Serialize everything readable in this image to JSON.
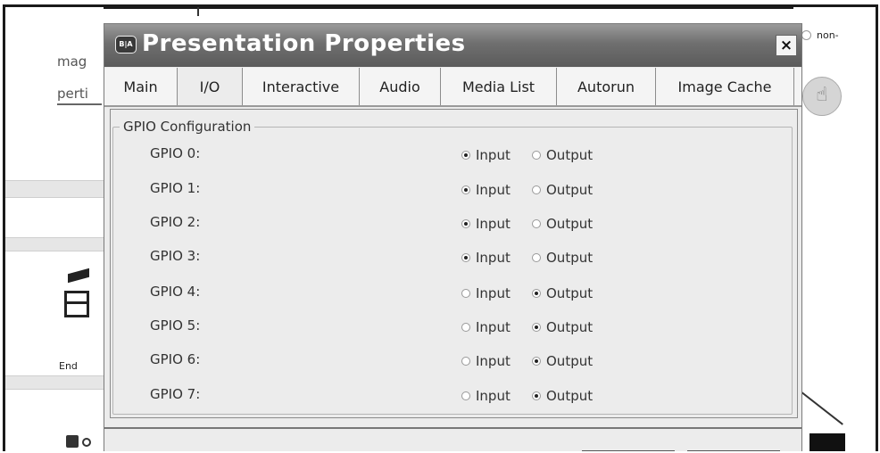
{
  "background": {
    "left_texts": [
      "mag",
      "perti",
      "End"
    ],
    "right_option": "non-"
  },
  "dialog": {
    "title": "Presentation Properties",
    "app_icon_text": "B|A",
    "close_glyph": "×",
    "tabs": [
      {
        "label": "Main",
        "active": false
      },
      {
        "label": "I/O",
        "active": true
      },
      {
        "label": "Interactive",
        "active": false
      },
      {
        "label": "Audio",
        "active": false
      },
      {
        "label": "Media List",
        "active": false
      },
      {
        "label": "Autorun",
        "active": false
      },
      {
        "label": "Image Cache",
        "active": false
      }
    ],
    "group_title": "GPIO Configuration",
    "option_input": "Input",
    "option_output": "Output",
    "gpio": [
      {
        "label": "GPIO 0:",
        "mode": "Input"
      },
      {
        "label": "GPIO 1:",
        "mode": "Input"
      },
      {
        "label": "GPIO 2:",
        "mode": "Input"
      },
      {
        "label": "GPIO 3:",
        "mode": "Input"
      },
      {
        "label": "GPIO 4:",
        "mode": "Output"
      },
      {
        "label": "GPIO 5:",
        "mode": "Output"
      },
      {
        "label": "GPIO 6:",
        "mode": "Output"
      },
      {
        "label": "GPIO 7:",
        "mode": "Output"
      }
    ]
  },
  "colors": {
    "titlebar": "#6f6f6f",
    "dialog_bg": "#ececec"
  }
}
